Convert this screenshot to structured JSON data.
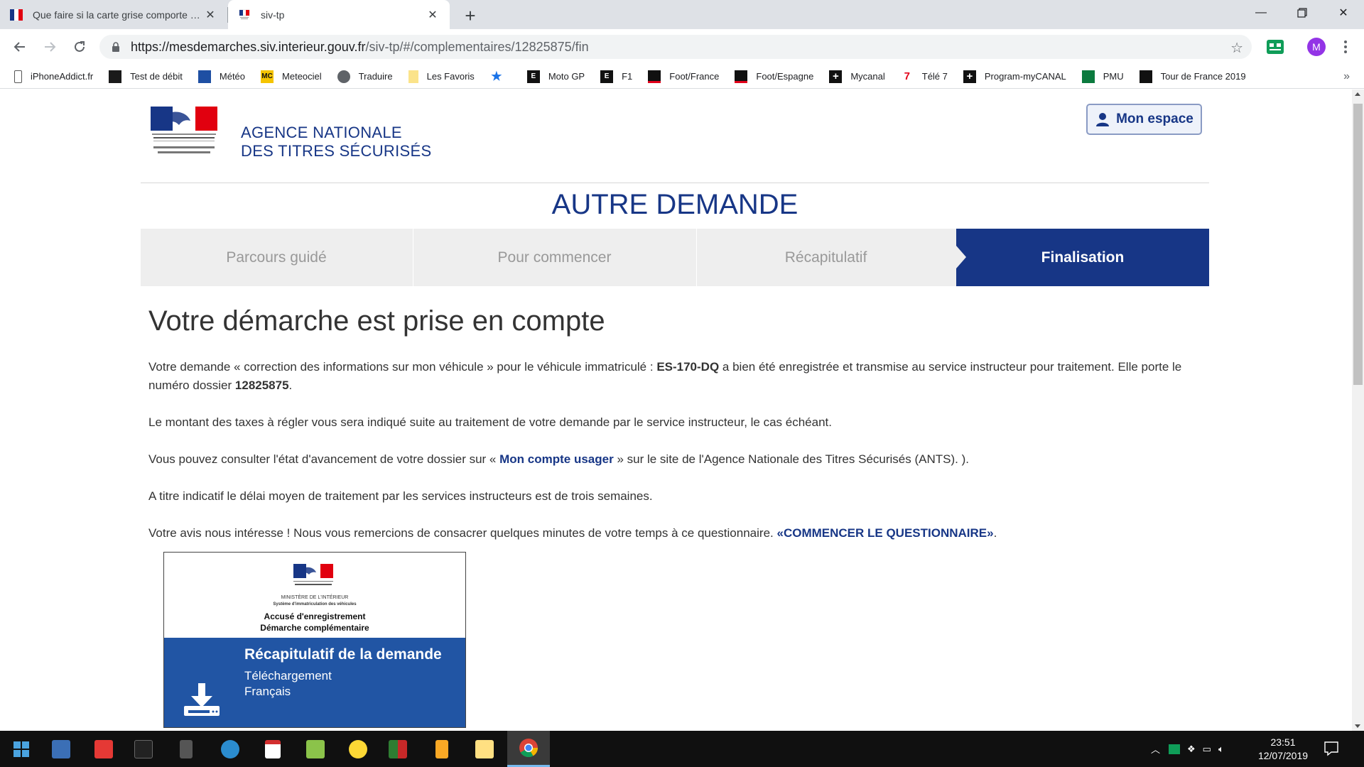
{
  "browser": {
    "tabs": [
      {
        "title": "Que faire si la carte grise comporte une erreur ?",
        "active": false
      },
      {
        "title": "siv-tp",
        "active": true
      }
    ],
    "url_host": "https://mesdemarches.siv.interieur.gouv.fr",
    "url_path": "/siv-tp/#/complementaires/12825875/fin",
    "profile_initial": "M",
    "bookmarks": [
      {
        "label": "iPhoneAddict.fr",
        "icon": "phone-icon",
        "color": "#ffffff"
      },
      {
        "label": "Test de débit",
        "icon": "speedtest-icon",
        "color": "#1a1a1a"
      },
      {
        "label": "Météo",
        "icon": "weather-icon",
        "color": "#1e4fa3"
      },
      {
        "label": "Meteociel",
        "icon": "mc-icon",
        "color": "#f5c400"
      },
      {
        "label": "Traduire",
        "icon": "globe-icon",
        "color": "#5f6368"
      },
      {
        "label": "Les Favoris",
        "icon": "folder-icon",
        "color": "#fbe38a"
      },
      {
        "label": "",
        "icon": "star-icon",
        "color": "#1a73e8"
      },
      {
        "label": "Moto GP",
        "icon": "equipe-icon",
        "color": "#111111"
      },
      {
        "label": "F1",
        "icon": "equipe-icon",
        "color": "#111111"
      },
      {
        "label": "Foot/France",
        "icon": "sm-icon",
        "color": "#111111"
      },
      {
        "label": "Foot/Espagne",
        "icon": "sm-icon",
        "color": "#111111"
      },
      {
        "label": "Mycanal",
        "icon": "plus-icon",
        "color": "#111111"
      },
      {
        "label": "Télé 7",
        "icon": "t7-icon",
        "color": "#e2001a"
      },
      {
        "label": "Program-myCANAL",
        "icon": "plus-icon",
        "color": "#111111"
      },
      {
        "label": "PMU",
        "icon": "pmu-icon",
        "color": "#0b7a3e"
      },
      {
        "label": "Tour de France 2019",
        "icon": "tdf-icon",
        "color": "#111111"
      }
    ]
  },
  "site": {
    "agency_line1": "AGENCE NATIONALE",
    "agency_line2": "DES TITRES SÉCURISÉS",
    "mon_espace": "Mon espace",
    "page_heading": "AUTRE DEMANDE",
    "steps": [
      "Parcours guidé",
      "Pour commencer",
      "Récapitulatif",
      "Finalisation"
    ],
    "active_step": "Finalisation",
    "accent_color": "#173686"
  },
  "content": {
    "title": "Votre démarche est prise en compte",
    "p1_a": "Votre demande « correction des informations sur mon véhicule » pour le véhicule immatriculé :",
    "plate": "ES-170-DQ",
    "p1_b": "a bien été enregistrée et transmise au service instructeur pour traitement. Elle porte le numéro dossier",
    "dossier": "12825875",
    "p1_end": ".",
    "p2": "Le montant des taxes à régler vous sera indiqué suite au traitement de votre demande par le service instructeur, le cas échéant.",
    "p3_a": "Vous pouvez consulter l'état d'avancement de votre dossier sur «",
    "p3_link": "Mon compte usager",
    "p3_b": "» sur le site de l'Agence Nationale des Titres Sécurisés (ANTS). ).",
    "p4": "A titre indicatif le délai moyen de traitement par les services instructeurs est de trois semaines.",
    "p5_a": "Votre avis nous intéresse ! Nous vous remercions de consacrer quelques minutes de votre temps à ce questionnaire.",
    "p5_link": "«COMMENCER LE QUESTIONNAIRE»",
    "p5_end": "."
  },
  "doc_card": {
    "ministere": "MINISTÈRE DE L'INTÉRIEUR",
    "systeme": "Système d'immatriculation des véhicules",
    "accuse_line1": "Accusé d'enregistrement",
    "accuse_line2": "Démarche complémentaire",
    "recap": "Récapitulatif de la demande",
    "download": "Téléchargement",
    "language": "Français"
  },
  "taskbar": {
    "time": "23:51",
    "date": "12/07/2019"
  }
}
